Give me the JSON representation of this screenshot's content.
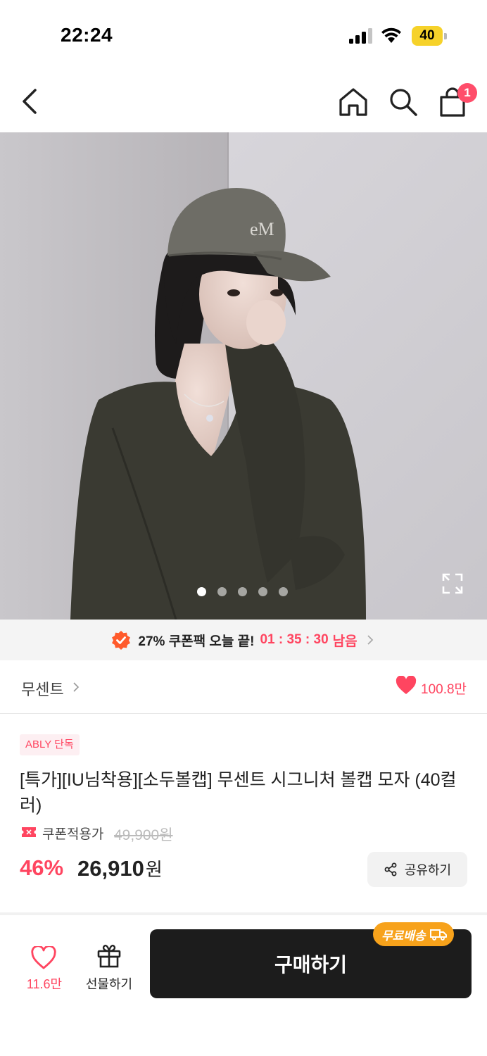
{
  "status": {
    "time": "22:24",
    "battery": "40"
  },
  "nav": {
    "cart_count": "1"
  },
  "gallery": {
    "image_count": 5,
    "active_index": 0
  },
  "coupon_banner": {
    "text": "27% 쿠폰팩 오늘 끝!",
    "timer": "01 : 35 : 30",
    "remain": "남음"
  },
  "store": {
    "name": "무센트",
    "likes": "100.8만"
  },
  "product": {
    "badge": "ABLY 단독",
    "title": "[특가][IU님착용][소두볼캡] 무센트 시그니처 볼캡 모자 (40컬러)",
    "coupon_label": "쿠폰적용가",
    "original_price": "49,900원",
    "discount_rate": "46%",
    "sale_price": "26,910",
    "currency": "원",
    "share_label": "공유하기"
  },
  "bottom_bar": {
    "wish_count": "11.6만",
    "gift_label": "선물하기",
    "buy_label": "구매하기",
    "free_shipping": "무료배송"
  },
  "colors": {
    "accent": "#ff4560",
    "badge_orange": "#f7a21b",
    "buy_button": "#1c1c1c"
  }
}
